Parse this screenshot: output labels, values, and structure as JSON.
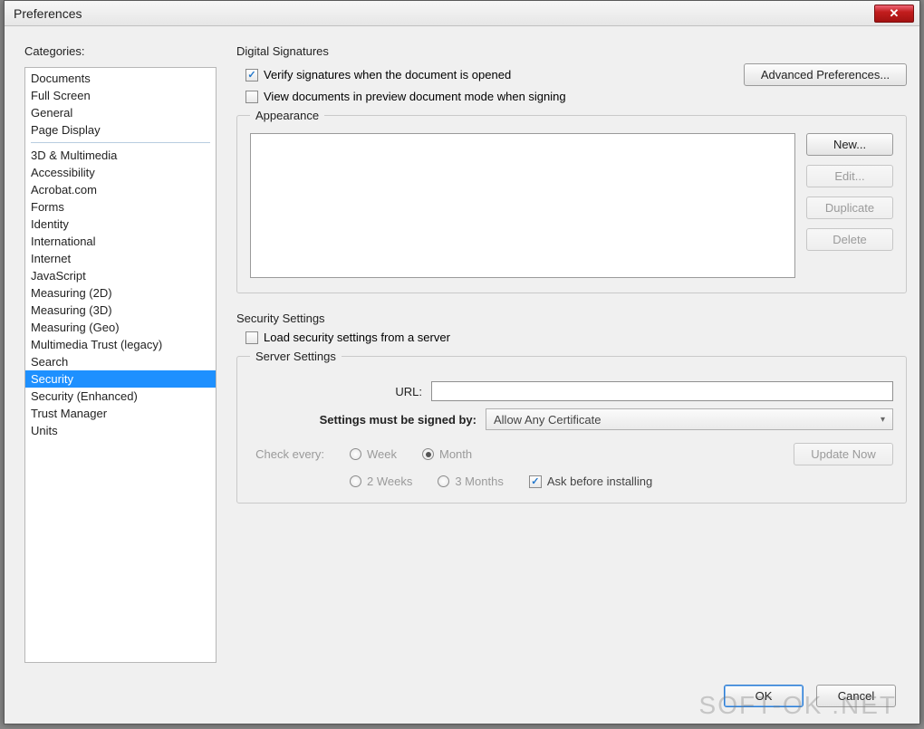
{
  "window": {
    "title": "Preferences",
    "close_label": "✕"
  },
  "sidebar": {
    "label": "Categories:",
    "group1": [
      "Documents",
      "Full Screen",
      "General",
      "Page Display"
    ],
    "group2": [
      "3D & Multimedia",
      "Accessibility",
      "Acrobat.com",
      "Forms",
      "Identity",
      "International",
      "Internet",
      "JavaScript",
      "Measuring (2D)",
      "Measuring (3D)",
      "Measuring (Geo)",
      "Multimedia Trust (legacy)",
      "Search",
      "Security",
      "Security (Enhanced)",
      "Trust Manager",
      "Units"
    ],
    "selected": "Security"
  },
  "digital": {
    "heading": "Digital Signatures",
    "verify_label": "Verify signatures when the document is opened",
    "verify_checked": true,
    "preview_label": "View documents in preview document mode when signing",
    "preview_checked": false,
    "advanced_btn": "Advanced Preferences...",
    "appearance_legend": "Appearance",
    "btn_new": "New...",
    "btn_edit": "Edit...",
    "btn_duplicate": "Duplicate",
    "btn_delete": "Delete"
  },
  "security": {
    "heading": "Security Settings",
    "load_label": "Load security settings from a server",
    "load_checked": false,
    "server_legend": "Server Settings",
    "url_label": "URL:",
    "url_value": "",
    "signed_label": "Settings must be signed by:",
    "signed_value": "Allow Any Certificate",
    "check_label": "Check every:",
    "opt_week": "Week",
    "opt_month": "Month",
    "opt_2weeks": "2 Weeks",
    "opt_3months": "3 Months",
    "ask_label": "Ask before installing",
    "ask_checked": true,
    "update_btn": "Update Now",
    "selected_interval": "Month"
  },
  "footer": {
    "ok": "OK",
    "cancel": "Cancel"
  },
  "watermark": "SOFT-OK .NET"
}
